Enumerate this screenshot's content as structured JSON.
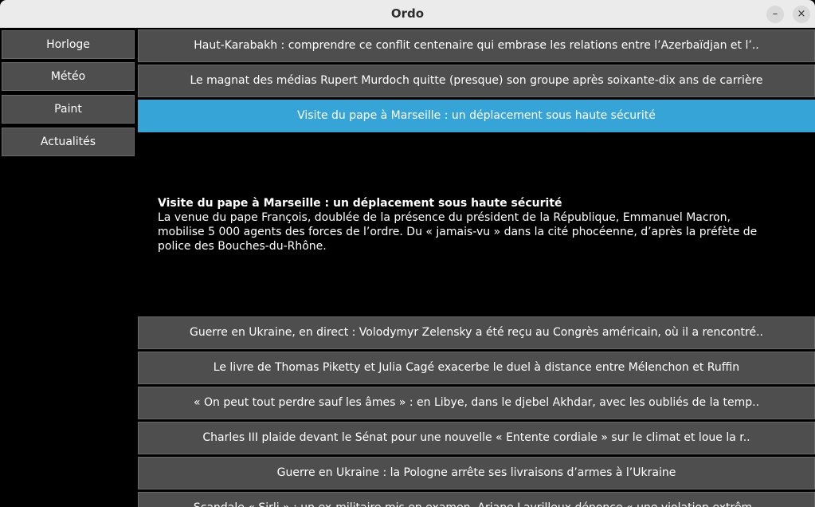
{
  "window": {
    "title": "Ordo",
    "minimize_label": "–",
    "close_label": "×"
  },
  "sidebar": {
    "items": [
      {
        "label": "Horloge"
      },
      {
        "label": "Météo"
      },
      {
        "label": "Paint"
      },
      {
        "label": "Actualités"
      }
    ]
  },
  "news": {
    "items": [
      {
        "label": "Haut-Karabakh : comprendre ce conflit centenaire qui embrase les relations entre l’Azerbaïdjan et l’.."
      },
      {
        "label": "Le magnat des médias Rupert Murdoch quitte (presque) son groupe après soixante-dix ans de carrière"
      },
      {
        "label": "Visite du pape à Marseille : un déplacement sous haute sécurité"
      },
      {
        "label": "Guerre en Ukraine, en direct : Volodymyr Zelensky a été reçu au Congrès américain, où il a rencontré.."
      },
      {
        "label": "Le livre de Thomas Piketty et Julia Cagé exacerbe le duel à distance entre Mélenchon et Ruffin"
      },
      {
        "label": "« On peut tout perdre sauf les âmes » : en Libye, dans le djebel Akhdar, avec les oubliés de la temp.."
      },
      {
        "label": "Charles III plaide devant le Sénat pour une nouvelle « Entente cordiale » sur le climat et loue la r.."
      },
      {
        "label": "Guerre en Ukraine : la Pologne arrête ses livraisons d’armes à l’Ukraine"
      },
      {
        "label": "Scandale « Sirli » : un ex-militaire mis en examen, Ariane Lavrilleux dénonce « une violation extrêm.."
      }
    ],
    "selected_index": 2,
    "detail": {
      "title": "Visite du pape à Marseille : un déplacement sous haute sécurité",
      "body": "La venue du pape François, doublée de la présence du président de la République, Emmanuel Macron, mobilise 5 000 agents des forces de l’ordre. Du « jamais-vu » dans la cité phocéenne, d’après la préfète de police des Bouches-du-Rhône."
    }
  }
}
